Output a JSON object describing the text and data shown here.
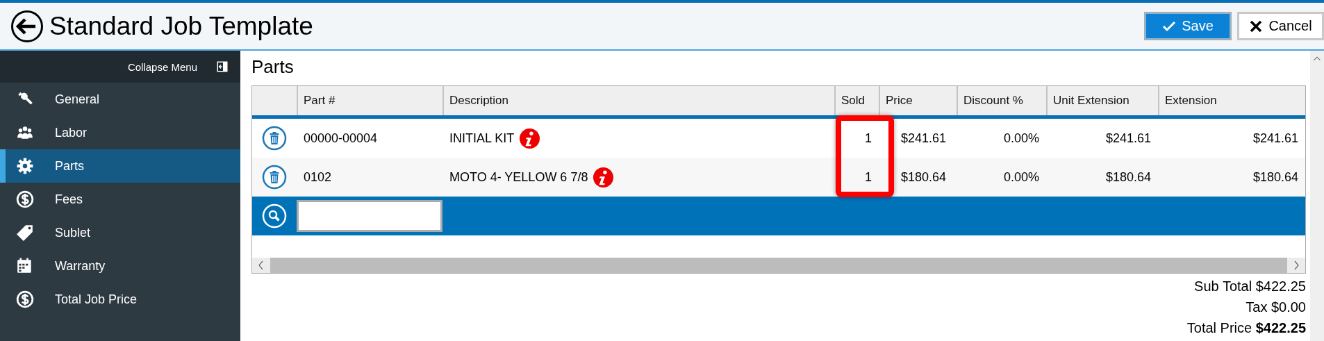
{
  "header": {
    "title": "Standard Job Template",
    "buttons": [
      {
        "kind": "save",
        "label": "Save"
      },
      {
        "kind": "cancel",
        "label": "Cancel"
      }
    ]
  },
  "sidebar": {
    "collapse_label": "Collapse Menu",
    "items": [
      {
        "label": "General",
        "selected": false
      },
      {
        "label": "Labor",
        "selected": false
      },
      {
        "label": "Parts",
        "selected": true
      },
      {
        "label": "Fees",
        "selected": false
      },
      {
        "label": "Sublet",
        "selected": false
      },
      {
        "label": "Warranty",
        "selected": false
      },
      {
        "label": "Total Job Price",
        "selected": false
      }
    ]
  },
  "section_title": "Parts",
  "table": {
    "columns": [
      "Part #",
      "Description",
      "Sold",
      "Price",
      "Discount %",
      "Unit Extension",
      "Extension"
    ],
    "sold_highlighted": true,
    "rows": [
      {
        "part": "00000-00004",
        "description": "INITIAL KIT",
        "info": true,
        "sold": "1",
        "price": "$241.61",
        "discount": "0.00%",
        "unit_extension": "$241.61",
        "extension": "$241.61"
      },
      {
        "part": "0102",
        "description": "MOTO 4- YELLOW 6 7/8",
        "info": true,
        "sold": "1",
        "price": "$180.64",
        "discount": "0.00%",
        "unit_extension": "$180.64",
        "extension": "$180.64"
      }
    ]
  },
  "totals": {
    "sub_total": "Sub Total $422.25",
    "tax": "Tax $0.00",
    "total_label": "Total Price",
    "total_value": "$422.25"
  }
}
